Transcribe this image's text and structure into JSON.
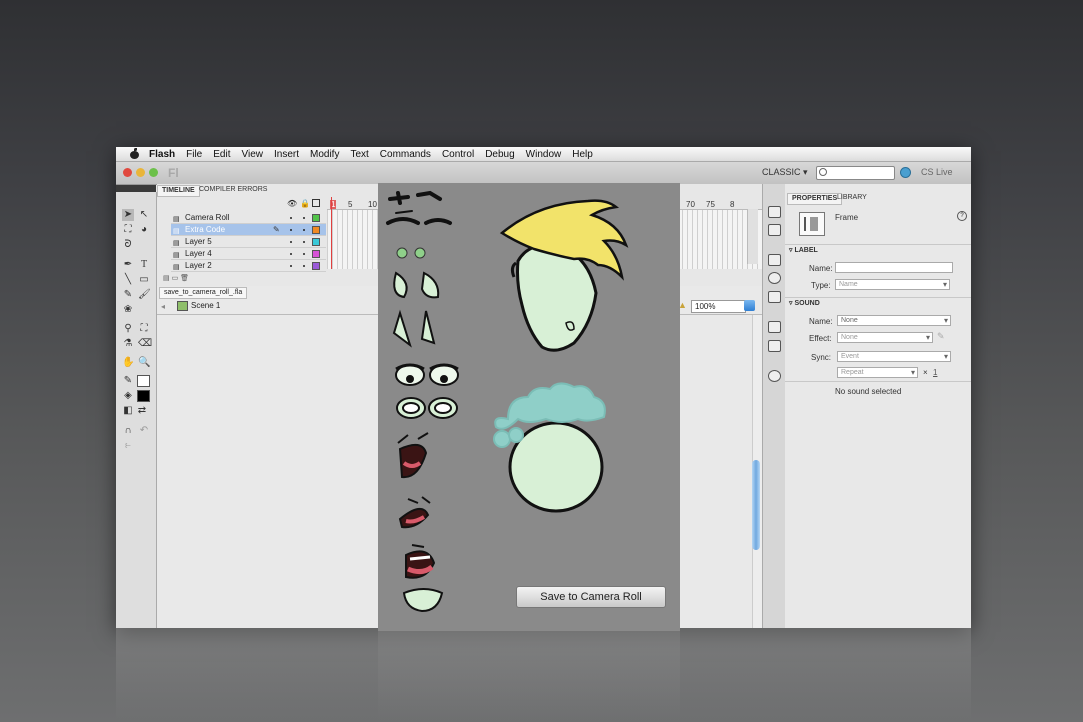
{
  "menubar": {
    "app": "Flash",
    "items": [
      "File",
      "Edit",
      "View",
      "Insert",
      "Modify",
      "Text",
      "Commands",
      "Control",
      "Debug",
      "Window",
      "Help"
    ]
  },
  "toolbar": {
    "logo": "Fl",
    "workspace": "CLASSIC ▾",
    "search_placeholder": "",
    "cs_live": "CS Live"
  },
  "timeline": {
    "tabs": [
      "TIMELINE",
      "COMPILER ERRORS"
    ],
    "layers": [
      {
        "name": "Camera Roll",
        "color": "#52c44a",
        "selected": false
      },
      {
        "name": "Extra Code",
        "color": "#f08a24",
        "selected": true
      },
      {
        "name": "Layer 5",
        "color": "#39c9d8",
        "selected": false
      },
      {
        "name": "Layer 4",
        "color": "#d653d6",
        "selected": false
      },
      {
        "name": "Layer 2",
        "color": "#9a5ad8",
        "selected": false
      }
    ],
    "frame_numbers": [
      "1",
      "5",
      "10",
      "70",
      "75",
      "8"
    ]
  },
  "editbar": {
    "doc_tab": "save_to_camera_roll_.fla",
    "scene": "Scene 1",
    "zoom": "100%"
  },
  "properties": {
    "tabs": [
      "PROPERTIES",
      "LIBRARY"
    ],
    "object_type": "Frame",
    "label_section": "LABEL",
    "name_label": "Name:",
    "type_label": "Type:",
    "type_value": "Name",
    "sound_section": "SOUND",
    "sound_name_label": "Name:",
    "sound_name_value": "None",
    "effect_label": "Effect:",
    "effect_value": "None",
    "sync_label": "Sync:",
    "sync_value": "Event",
    "repeat_value": "Repeat",
    "repeat_x": "×",
    "repeat_count": "1",
    "no_sound": "No sound selected"
  },
  "app_overlay": {
    "save_button": "Save to Camera Roll"
  }
}
